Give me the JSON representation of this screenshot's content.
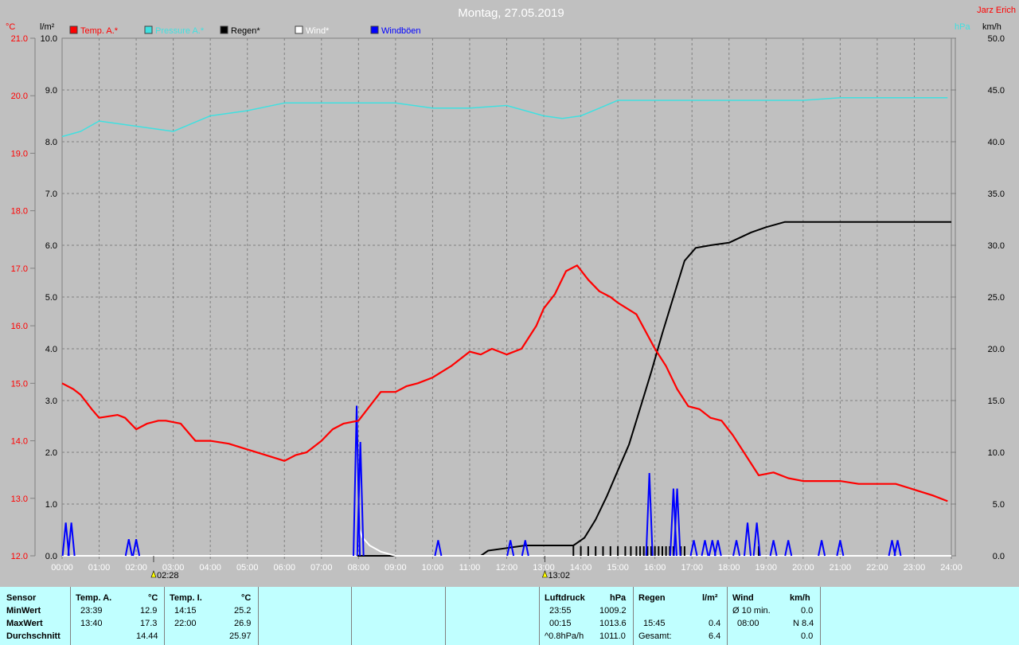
{
  "header": {
    "title": "Montag, 27.05.2019",
    "author": "Jarz Erich"
  },
  "colors": {
    "temp": "#ff0000",
    "pressure": "#40e0e0",
    "rain": "#000000",
    "wind": "#ffffff",
    "gust": "#0000ff",
    "grid": "#808080"
  },
  "chart_data": {
    "type": "line",
    "title": "Montag, 27.05.2019",
    "x_ticks": [
      "00:00",
      "01:00",
      "02:00",
      "03:00",
      "04:00",
      "05:00",
      "06:00",
      "07:00",
      "08:00",
      "09:00",
      "10:00",
      "11:00",
      "12:00",
      "13:00",
      "14:00",
      "15:00",
      "16:00",
      "17:00",
      "18:00",
      "19:00",
      "20:00",
      "21:00",
      "22:00",
      "23:00",
      "24:00"
    ],
    "x_range": [
      0,
      24
    ],
    "axes": {
      "temp": {
        "unit": "°C",
        "range": [
          12,
          21
        ],
        "ticks": [
          "12.0",
          "13.0",
          "14.0",
          "15.0",
          "16.0",
          "17.0",
          "18.0",
          "19.0",
          "20.0",
          "21.0"
        ]
      },
      "rain": {
        "unit": "l/m²",
        "range": [
          0,
          10
        ],
        "ticks": [
          "0.0",
          "1.0",
          "2.0",
          "3.0",
          "4.0",
          "5.0",
          "6.0",
          "7.0",
          "8.0",
          "9.0",
          "10.0"
        ]
      },
      "pressure": {
        "unit": "hPa",
        "range": [
          1000,
          1010
        ]
      },
      "wind": {
        "unit": "km/h",
        "range": [
          0,
          50
        ],
        "ticks": [
          "0.0",
          "5.0",
          "10.0",
          "15.0",
          "20.0",
          "25.0",
          "30.0",
          "35.0",
          "40.0",
          "45.0",
          "50.0"
        ]
      }
    },
    "grid": true,
    "legend": [
      {
        "label": "Temp. A.*",
        "color": "#ff0000"
      },
      {
        "label": "Pressure A.*",
        "color": "#40e0e0"
      },
      {
        "label": "Regen*",
        "color": "#000000"
      },
      {
        "label": "Wind*",
        "color": "#ffffff"
      },
      {
        "label": "Windböen",
        "color": "#0000ff"
      }
    ],
    "series": [
      {
        "name": "Temp. A.*",
        "axis": "temp",
        "color": "#ff0000",
        "x": [
          0,
          0.3,
          0.5,
          0.8,
          1.0,
          1.5,
          1.7,
          2.0,
          2.3,
          2.6,
          2.8,
          3.2,
          3.6,
          4.0,
          4.5,
          5.0,
          5.5,
          6.0,
          6.3,
          6.6,
          7.0,
          7.3,
          7.6,
          8.0,
          8.3,
          8.6,
          9.0,
          9.3,
          9.6,
          10.0,
          10.5,
          11.0,
          11.3,
          11.6,
          12.0,
          12.4,
          12.8,
          13.0,
          13.3,
          13.6,
          13.9,
          14.2,
          14.5,
          14.8,
          15.0,
          15.5,
          16.0,
          16.3,
          16.6,
          16.9,
          17.2,
          17.5,
          17.8,
          18.1,
          18.4,
          18.8,
          19.2,
          19.6,
          20.0,
          21.0,
          21.5,
          22.0,
          22.5,
          23.0,
          23.5,
          23.9
        ],
        "y": [
          15.0,
          14.9,
          14.8,
          14.55,
          14.4,
          14.45,
          14.4,
          14.2,
          14.3,
          14.35,
          14.35,
          14.3,
          14.0,
          14.0,
          13.95,
          13.85,
          13.75,
          13.65,
          13.75,
          13.8,
          14.0,
          14.2,
          14.3,
          14.35,
          14.6,
          14.85,
          14.85,
          14.95,
          15.0,
          15.1,
          15.3,
          15.55,
          15.5,
          15.6,
          15.5,
          15.6,
          16.0,
          16.3,
          16.55,
          16.95,
          17.05,
          16.8,
          16.6,
          16.5,
          16.4,
          16.2,
          15.6,
          15.3,
          14.9,
          14.6,
          14.55,
          14.4,
          14.35,
          14.1,
          13.8,
          13.4,
          13.45,
          13.35,
          13.3,
          13.3,
          13.25,
          13.25,
          13.25,
          13.15,
          13.05,
          12.95
        ]
      },
      {
        "name": "Pressure A.*",
        "axis": "pressure",
        "color": "#40e0e0",
        "x": [
          0,
          0.5,
          1.0,
          1.5,
          2.0,
          2.5,
          3.0,
          3.5,
          4.0,
          5.0,
          6.0,
          7.0,
          8.0,
          9.0,
          10.0,
          11.0,
          12.0,
          12.5,
          13.0,
          13.5,
          14.0,
          14.5,
          15.0,
          16.0,
          17.0,
          18.0,
          19.0,
          20.0,
          21.0,
          22.0,
          23.0,
          23.9
        ],
        "y": [
          1008.1,
          1008.2,
          1008.4,
          1008.35,
          1008.3,
          1008.25,
          1008.2,
          1008.35,
          1008.5,
          1008.6,
          1008.75,
          1008.75,
          1008.75,
          1008.75,
          1008.65,
          1008.65,
          1008.7,
          1008.6,
          1008.5,
          1008.45,
          1008.5,
          1008.65,
          1008.8,
          1008.8,
          1008.8,
          1008.8,
          1008.8,
          1008.8,
          1008.85,
          1008.85,
          1008.85,
          1008.85
        ]
      },
      {
        "name": "Regen*",
        "axis": "rain",
        "color": "#000000",
        "x": [
          0,
          11.3,
          11.5,
          12.0,
          12.5,
          13.0,
          13.8,
          14.1,
          14.4,
          14.7,
          15.0,
          15.3,
          15.6,
          15.9,
          16.2,
          16.5,
          16.8,
          17.1,
          17.5,
          18.0,
          18.3,
          18.6,
          19.0,
          19.5,
          20.0,
          24.0
        ],
        "y": [
          0,
          0,
          0.1,
          0.15,
          0.2,
          0.2,
          0.2,
          0.35,
          0.7,
          1.15,
          1.65,
          2.15,
          2.85,
          3.55,
          4.3,
          5.0,
          5.7,
          5.95,
          6.0,
          6.05,
          6.15,
          6.25,
          6.35,
          6.45,
          6.45,
          6.45
        ]
      },
      {
        "name": "Wind*",
        "axis": "wind",
        "color": "#ffffff",
        "x": [
          0,
          7.95,
          8.0,
          8.1,
          8.3,
          8.6,
          9.0,
          24.0
        ],
        "y": [
          0,
          0,
          2.8,
          1.8,
          1.0,
          0.4,
          0,
          0
        ]
      },
      {
        "name": "Windböen",
        "axis": "wind",
        "color": "#0000ff",
        "spikes": [
          [
            0.1,
            3.2
          ],
          [
            0.25,
            3.2
          ],
          [
            1.8,
            1.6
          ],
          [
            2.0,
            1.6
          ],
          [
            7.95,
            14.5
          ],
          [
            8.05,
            11.0
          ],
          [
            10.15,
            1.5
          ],
          [
            12.1,
            1.5
          ],
          [
            12.5,
            1.5
          ],
          [
            15.85,
            8.0
          ],
          [
            16.5,
            6.5
          ],
          [
            16.6,
            6.5
          ],
          [
            17.05,
            1.5
          ],
          [
            17.35,
            1.5
          ],
          [
            17.55,
            1.5
          ],
          [
            17.7,
            1.5
          ],
          [
            18.2,
            1.5
          ],
          [
            18.5,
            3.2
          ],
          [
            18.75,
            3.2
          ],
          [
            19.2,
            1.5
          ],
          [
            19.6,
            1.5
          ],
          [
            20.5,
            1.5
          ],
          [
            21.0,
            1.5
          ],
          [
            22.4,
            1.5
          ],
          [
            22.55,
            1.5
          ]
        ]
      }
    ],
    "rain_ticks_x": [
      13.8,
      14.0,
      14.2,
      14.4,
      14.6,
      14.8,
      15.0,
      15.2,
      15.35,
      15.5,
      15.6,
      15.7,
      15.8,
      15.9,
      16.0,
      16.1,
      16.2,
      16.3,
      16.4,
      16.5,
      16.7,
      16.8,
      18.8
    ],
    "markers": [
      {
        "x": 2.47,
        "label": "02:28"
      },
      {
        "x": 13.03,
        "label": "13:02"
      }
    ]
  },
  "stats": {
    "sensor_header": "Sensor",
    "min_label": "MinWert",
    "max_label": "MaxWert",
    "avg_label": "Durchschnitt",
    "temp_a": {
      "title": "Temp. A.",
      "unit": "°C",
      "min_time": "23:39",
      "min": "12.9",
      "max_time": "13:40",
      "max": "17.3",
      "avg": "14.44"
    },
    "temp_i": {
      "title": "Temp. I.",
      "unit": "°C",
      "min_time": "14:15",
      "min": "25.2",
      "max_time": "22:00",
      "max": "26.9",
      "avg": "25.97"
    },
    "pressure": {
      "title": "Luftdruck",
      "unit": "hPa",
      "min_time": "23:55",
      "min": "1009.2",
      "max_time": "00:15",
      "max": "1013.6",
      "trend_label": "^0.8hPa/h",
      "avg": "1011.0"
    },
    "rain": {
      "title": "Regen",
      "unit": "l/m²",
      "max_time": "15:45",
      "max": "0.4",
      "total_label": "Gesamt:",
      "total": "6.4"
    },
    "wind": {
      "title": "Wind",
      "unit": "km/h",
      "avg10_label": "Ø 10 min.",
      "avg10": "0.0",
      "max_time": "08:00",
      "max": "N 8.4",
      "avg": "0.0"
    }
  }
}
